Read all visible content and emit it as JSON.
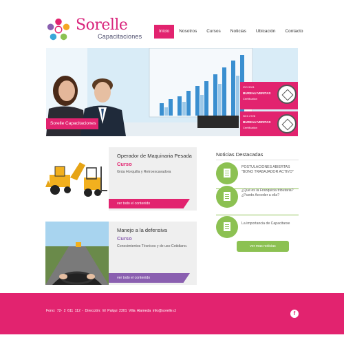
{
  "header": {
    "logo_text": "Sorelle",
    "logo_subtitle": "Capacitaciones",
    "nav": [
      "Inicio",
      "Nosotros",
      "Cursos",
      "Noticias",
      "Ubicación",
      "Contacto"
    ],
    "active_nav": "Inicio"
  },
  "hero": {
    "label": "Sorelle Capacitaciones",
    "cert1_line1": "ISO 9001",
    "cert1_line2": "BUREAU VERITAS",
    "cert1_line3": "Certification",
    "cert2_line1": "NCh 2728",
    "cert2_line2": "BUREAU VERITAS",
    "cert2_line3": "Certification"
  },
  "courses": [
    {
      "title": "Operador de Maquinaria Pesada",
      "subtitle": "Curso",
      "description": "Grúa Horquilla y Retroexcavadora",
      "more": "ver todo el contenido",
      "accent": "#e2236f"
    },
    {
      "title": "Manejo a la defensiva",
      "subtitle": "Curso",
      "description": "Conocimientos Técnicos y de uso Cotidiano.",
      "more": "ver todo el contenido",
      "accent": "#8a5fb0"
    }
  ],
  "news": {
    "heading": "Noticias Destacadas",
    "items": [
      "POSTULACIONES ABIERTAS \"BONO TRABAJADOR ACTIVO\"",
      "¿Qué es la Franquicia tributaria? ¿Puedo Acceder a ella?",
      "La importancia de Capacitarse"
    ],
    "button": "ver mas noticias",
    "accent": "#8cc152"
  },
  "footer": {
    "text": "Fono: 72- 2 611 112 - Dirección: El Palqui 2301 Villa Alameda     info@sorelle.cl",
    "social_icon": "facebook-icon",
    "background": "#e2236f"
  }
}
